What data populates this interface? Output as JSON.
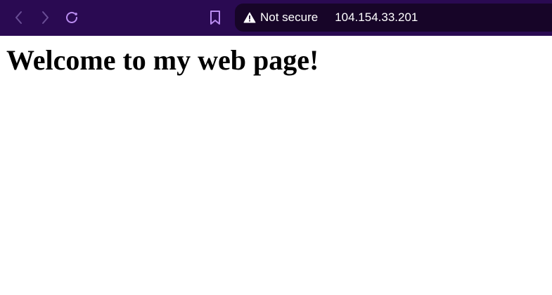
{
  "browser": {
    "security_label": "Not secure",
    "url": "104.154.33.201",
    "colors": {
      "toolbar": "#2a0a52",
      "address_bar": "#170528",
      "icon_active": "#b98cf0",
      "icon_disabled": "#6a4e96"
    },
    "icons": [
      "back-arrow",
      "forward-arrow",
      "reload",
      "bookmark",
      "warning-triangle"
    ]
  },
  "page": {
    "heading": "Welcome to my web page!"
  }
}
